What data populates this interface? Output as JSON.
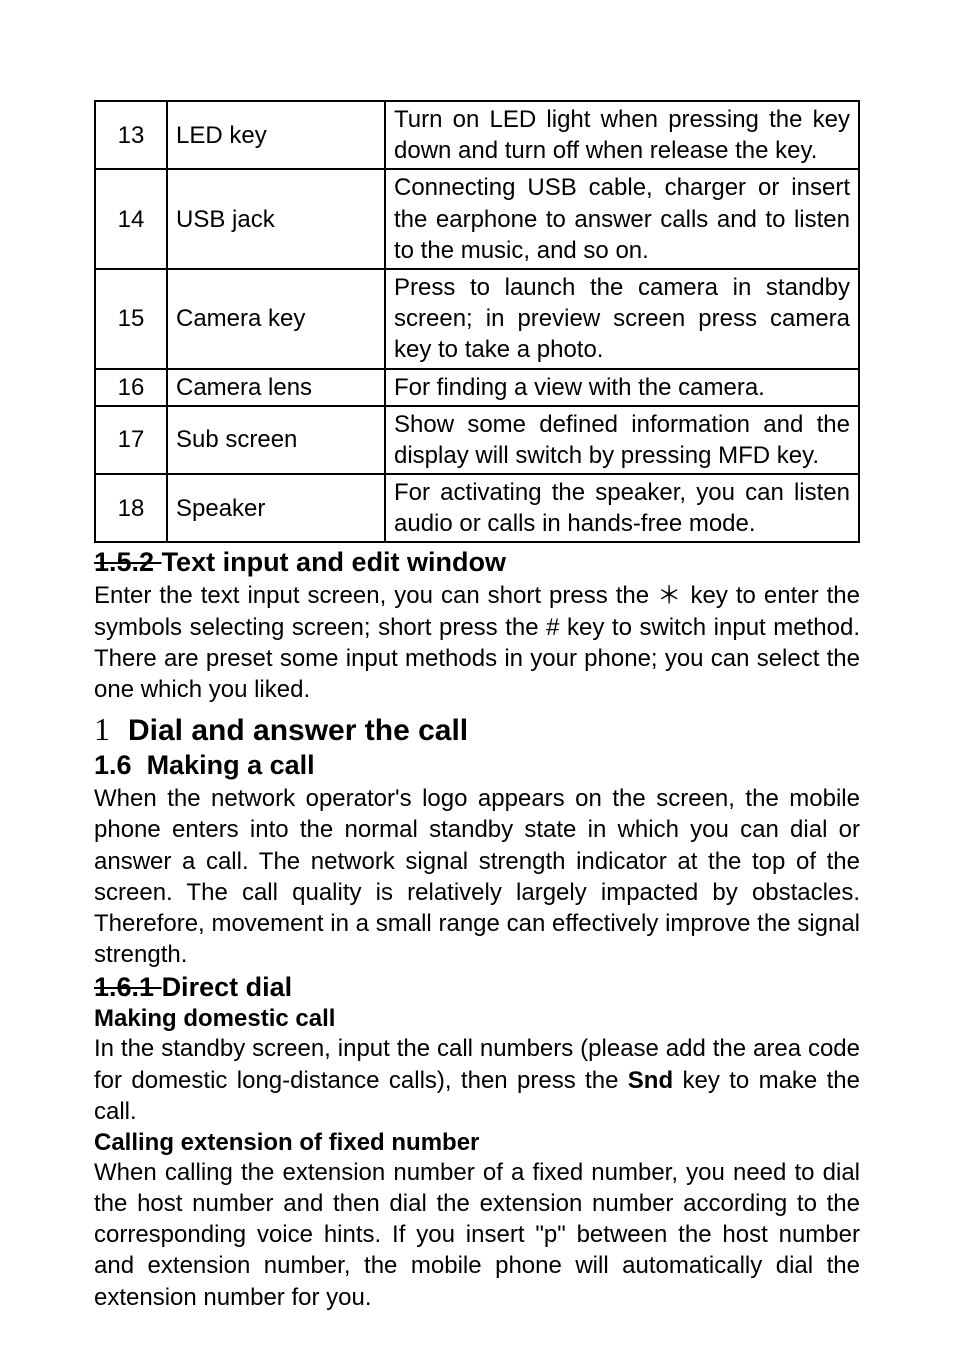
{
  "table": {
    "rows": [
      {
        "num": "13",
        "name": "LED key",
        "desc": "Turn on LED light when pressing the key down and turn off when release the key."
      },
      {
        "num": "14",
        "name": "USB jack",
        "desc": "Connecting USB cable, charger or insert the earphone to answer calls and to listen to the music, and so on."
      },
      {
        "num": "15",
        "name": "Camera key",
        "desc": "Press to launch the camera in standby screen; in preview screen press camera key to take a photo."
      },
      {
        "num": "16",
        "name": "Camera lens",
        "desc": "For finding a view with the camera."
      },
      {
        "num": "17",
        "name": "Sub screen",
        "desc": "Show some defined information and the display will switch by pressing MFD key."
      },
      {
        "num": "18",
        "name": "Speaker",
        "desc": "For activating the speaker, you can listen audio or calls in hands-free mode."
      }
    ]
  },
  "s152": {
    "num": "1.5.2 ",
    "title": "Text input and edit window",
    "body": "Enter the text input screen, you can short press the ＊ key to enter the symbols selecting screen; short press the # key to switch input method. There are preset some input methods in your phone; you can select the one which you liked."
  },
  "chapter": {
    "num": "1",
    "title": "Dial and answer the call"
  },
  "s16": {
    "num": "1.6",
    "title": "Making a call",
    "body": "When the network operator's logo appears on the screen, the mobile phone enters into the normal standby state in which you can dial or answer a call. The network signal strength indicator at the top of the screen. The call quality is relatively largely impacted by obstacles. Therefore, movement in a small range can effectively improve the signal strength."
  },
  "s161": {
    "num": "1.6.1 ",
    "title": "Direct dial",
    "dom_title": "Making domestic call",
    "dom_body_a": "In the standby screen, input the call numbers (please add the area code for domestic long-distance calls), then press the ",
    "dom_body_snd": "Snd",
    "dom_body_b": " key to make the call.",
    "ext_title": "Calling extension of fixed number",
    "ext_body": "When calling the extension number of a fixed number, you need to dial the host number and then dial the extension number according to the corresponding voice hints. If you insert \"p\" between the host number and extension number, the mobile phone will automatically dial the extension number for you."
  }
}
